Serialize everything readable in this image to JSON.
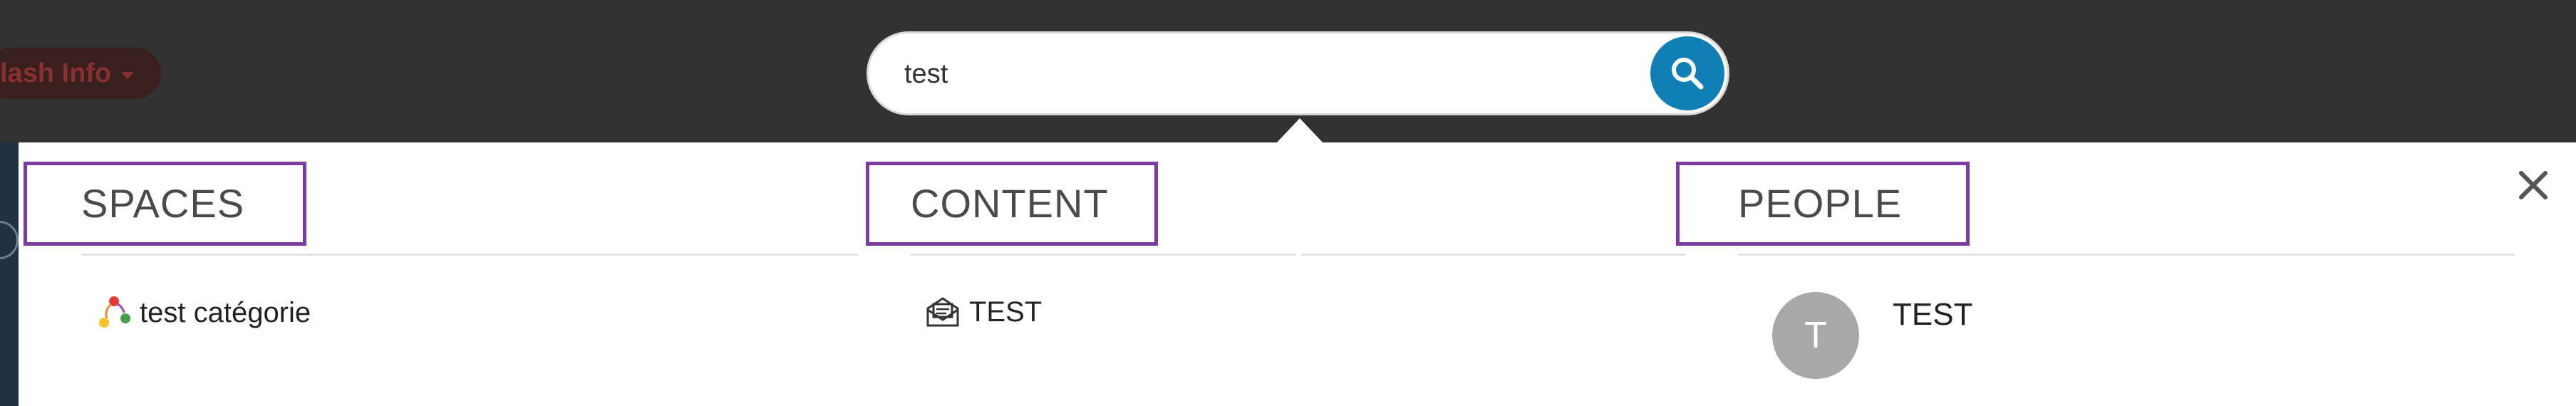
{
  "header": {
    "flash_label": "lash Info",
    "search": {
      "value": "test",
      "placeholder": ""
    }
  },
  "sections": {
    "spaces": {
      "title": "SPACES",
      "items": [
        {
          "label": "test catégorie",
          "icon": "space-icon"
        }
      ]
    },
    "content": {
      "title": "CONTENT",
      "items": [
        {
          "label": "TEST",
          "icon": "news-icon"
        }
      ]
    },
    "people": {
      "title": "PEOPLE",
      "items": [
        {
          "label": "TEST",
          "avatar_initial": "T"
        }
      ]
    }
  },
  "colors": {
    "topbar": "#323232",
    "search_button": "#0f7fb6",
    "highlight_border": "#7b3ba0",
    "avatar": "#a8a8a8"
  }
}
